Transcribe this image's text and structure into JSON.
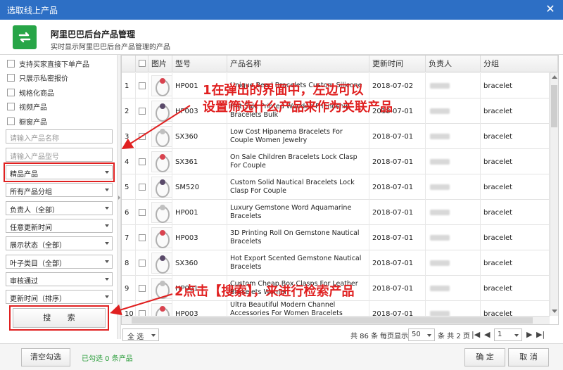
{
  "window": {
    "title": "选取线上产品"
  },
  "header": {
    "title": "阿里巴巴后台产品管理",
    "subtitle": "实时显示阿里巴巴后台产品管理的产品"
  },
  "filters": {
    "checkboxes": [
      "支持买家直接下单产品",
      "只展示私密报价",
      "规格化商品",
      "视频产品",
      "橱窗产品"
    ],
    "name_placeholder": "请输入产品名称",
    "model_placeholder": "请输入产品型号",
    "selects": [
      "精品产品",
      "所有产品分组",
      "负责人（全部）",
      "任意更新时间",
      "展示状态（全部）",
      "叶子类目（全部）",
      "审核通过",
      "更新时间（排序）"
    ],
    "search_label": "搜 索"
  },
  "table": {
    "columns": [
      "图片",
      "型号",
      "产品名称",
      "更新时间",
      "负责人",
      "分组"
    ],
    "rows": [
      {
        "num": "1",
        "model": "HP001",
        "name": "Unique Bead Bracelets Custom Silicone",
        "date": "2018-07-02",
        "group": "bracelet"
      },
      {
        "num": "2",
        "model": "HP003",
        "name": "Hot Sale Printed Wooden Friendship Bracelets Bulk",
        "date": "2018-07-01",
        "group": "bracelet"
      },
      {
        "num": "3",
        "model": "SX360",
        "name": "Low Cost Hipanema Bracelets For Couple Women Jewelry",
        "date": "2018-07-01",
        "group": "bracelet"
      },
      {
        "num": "4",
        "model": "SX361",
        "name": "On Sale Children Bracelets Lock Clasp For Couple",
        "date": "2018-07-01",
        "group": "bracelet"
      },
      {
        "num": "5",
        "model": "SM520",
        "name": "Custom Solid Nautical Bracelets Lock Clasp For Couple",
        "date": "2018-07-01",
        "group": "bracelet"
      },
      {
        "num": "6",
        "model": "HP001",
        "name": "Luxury Gemstone Word Aquamarine Bracelets",
        "date": "2018-07-01",
        "group": "bracelet"
      },
      {
        "num": "7",
        "model": "HP003",
        "name": "3D Printing Roll On Gemstone Nautical Bracelets",
        "date": "2018-07-01",
        "group": "bracelet"
      },
      {
        "num": "8",
        "model": "SX360",
        "name": "Hot Export Scented Gemstone Nautical Bracelets",
        "date": "2018-07-01",
        "group": "bracelet"
      },
      {
        "num": "9",
        "model": "HP001",
        "name": "Custom Cheap Box Clasps For Leather Bracelets Women",
        "date": "2018-07-01",
        "group": "bracelet"
      },
      {
        "num": "10",
        "model": "HP003",
        "name": "Ultra Beautiful Modern Channel Accessories For Women Bracelets Jewelry",
        "date": "2018-07-01",
        "group": "bracelet"
      }
    ]
  },
  "pager": {
    "select_all": "全 选",
    "total_prefix": "共 86 条",
    "per_page_label": "每页显示",
    "per_page": "50",
    "per_page_suffix": "条 共 2 页",
    "page": "1"
  },
  "footer": {
    "clear": "清空勾选",
    "selected": "已勾选 0 条产品",
    "ok": "确 定",
    "cancel": "取 消"
  },
  "annotations": {
    "a1_line1": "1在弹出的界面中，左边可以",
    "a1_line2": "设置筛选什么产品来作为关联产品",
    "a2": "2点击【搜索】，来进行检索产品"
  },
  "colors": {
    "titlebar": "#2d6fc5",
    "accent_green": "#27a547",
    "annotation_red": "#e02020"
  }
}
